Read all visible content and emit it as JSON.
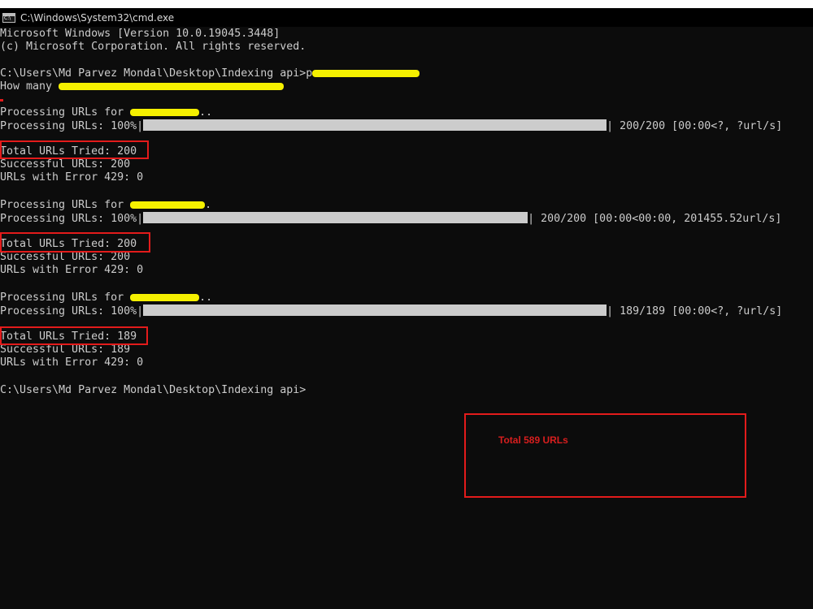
{
  "window": {
    "title": "C:\\Windows\\System32\\cmd.exe"
  },
  "console": {
    "header1": "Microsoft Windows [Version 10.0.19045.3448]",
    "header2": "(c) Microsoft Corporation. All rights reserved.",
    "prompt_path": "C:\\Users\\Md Parvez Mondal\\Desktop\\Indexing api>",
    "command_prefix": "p",
    "how_many": "How many ",
    "runs": [
      {
        "processing_for_prefix": "Processing URLs for ",
        "processing_for_suffix": "..",
        "progress_label": "Processing URLs: 100%|",
        "progress_value": 1.0,
        "progress_stats": "| 200/200 [00:00<?, ?url/s]",
        "total_tried": "Total URLs Tried: 200",
        "successful": "Successful URLs: 200",
        "errors": "URLs with Error 429: 0"
      },
      {
        "processing_for_prefix": "Processing URLs for ",
        "processing_for_suffix": ".",
        "progress_label": "Processing URLs: 100%|",
        "progress_value": 1.0,
        "progress_stats": "| 200/200 [00:00<00:00, 201455.52url/s]",
        "total_tried": "Total URLs Tried: 200",
        "successful": "Successful URLs: 200",
        "errors": "URLs with Error 429: 0"
      },
      {
        "processing_for_prefix": "Processing URLs for ",
        "processing_for_suffix": "..",
        "progress_label": "Processing URLs: 100%|",
        "progress_value": 1.0,
        "progress_stats": "| 189/189 [00:00<?, ?url/s]",
        "total_tried": "Total URLs Tried: 189",
        "successful": "Successful URLs: 189",
        "errors": "URLs with Error 429: 0"
      }
    ],
    "final_prompt": "C:\\Users\\Md Parvez Mondal\\Desktop\\Indexing api>"
  },
  "annotation": {
    "text": "Total 589 URLs"
  },
  "colors": {
    "console_bg": "#0c0c0c",
    "console_text": "#cccccc",
    "highlight": "#f5f000",
    "annotation_red": "#e31b1b"
  }
}
